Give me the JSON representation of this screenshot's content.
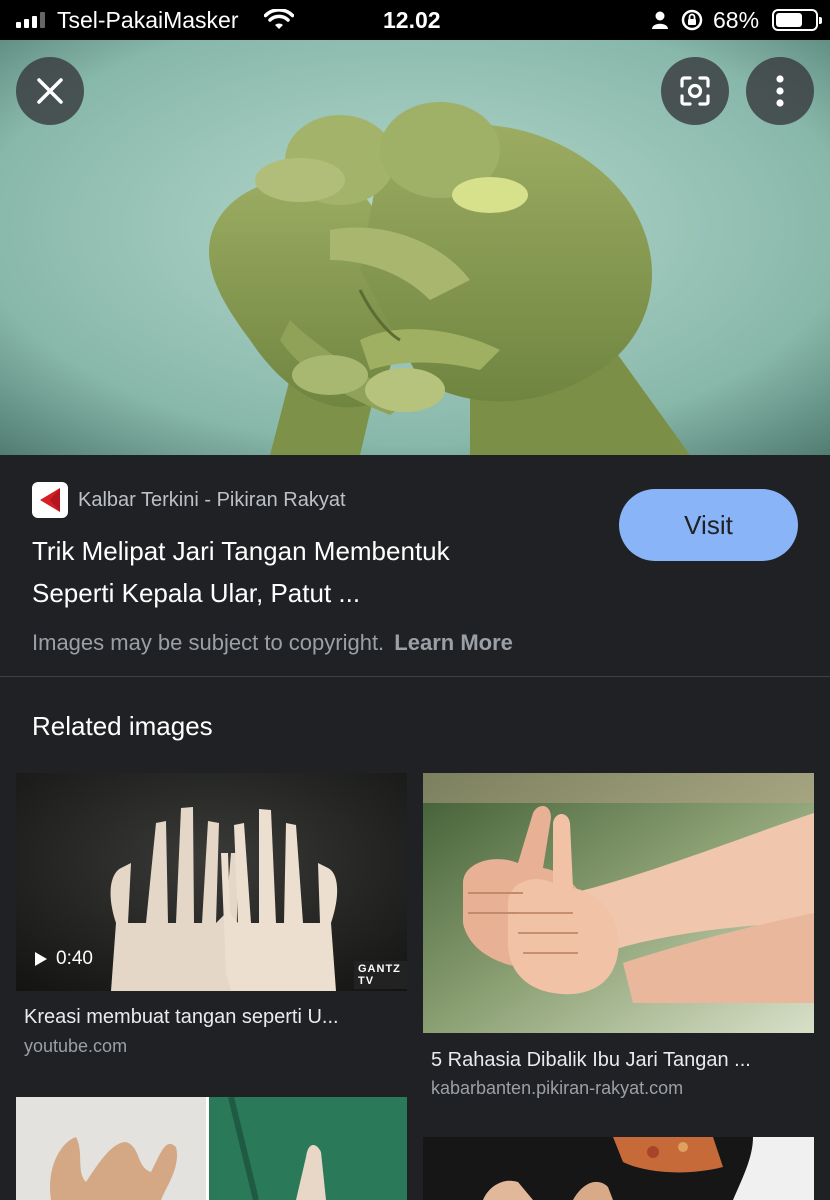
{
  "status_bar": {
    "carrier": "Tsel-PakaiMasker",
    "time": "12.02",
    "battery_percent": "68%",
    "battery_level": 0.68,
    "icons": [
      "signal-icon",
      "wifi-icon",
      "person-icon",
      "rotation-lock-icon",
      "battery-icon"
    ]
  },
  "viewer": {
    "close_icon": "close-icon",
    "lens_icon": "lens-icon",
    "more_icon": "more-vertical-icon"
  },
  "result": {
    "source_name": "Kalbar Terkini - Pikiran Rakyat",
    "title_line1": "Trik Melipat Jari Tangan Membentuk",
    "title_line2": "Seperti Kepala Ular, Patut ...",
    "visit_label": "Visit",
    "copyright_text": "Images may be subject to copyright.",
    "learn_more_label": "Learn More"
  },
  "related": {
    "heading": "Related images",
    "items": [
      {
        "caption": "Kreasi membuat tangan seperti U...",
        "domain": "youtube.com",
        "duration": "0:40",
        "watermark": "GANTZ TV"
      },
      {
        "caption": "5 Rahasia Dibalik Ibu Jari Tangan ...",
        "domain": "kabarbanten.pikiran-rakyat.com"
      }
    ]
  },
  "colors": {
    "background": "#202124",
    "visit_button": "#8ab4f8",
    "hero_bg": "#9fc9bd"
  }
}
